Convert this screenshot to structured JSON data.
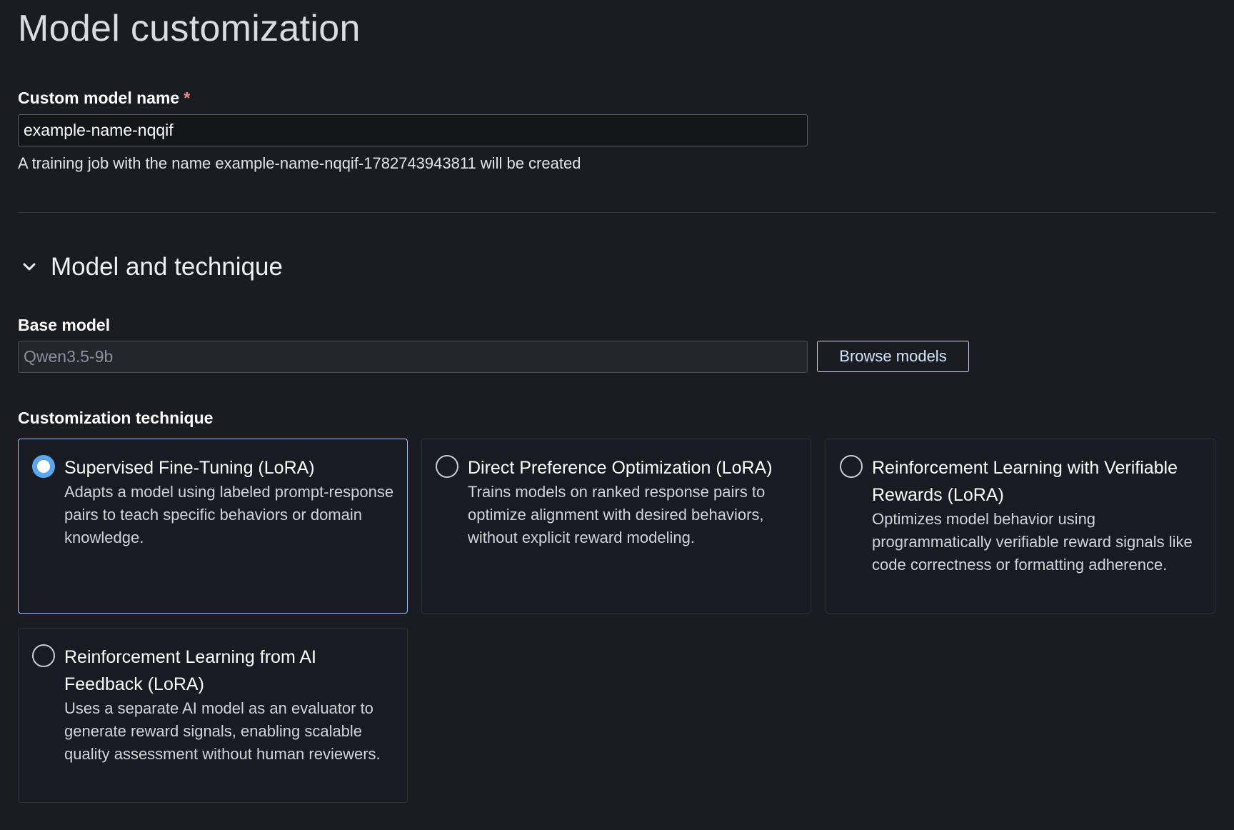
{
  "page": {
    "title": "Model customization"
  },
  "custom_model_name": {
    "label": "Custom model name",
    "required_marker": "*",
    "value": "example-name-nqqif",
    "hint": "A training job with the name example-name-nqqif-1782743943811 will be created"
  },
  "model_section": {
    "title": "Model and technique",
    "expanded": true,
    "base_model": {
      "label": "Base model",
      "value": "Qwen3.5-9b",
      "browse_label": "Browse models"
    },
    "technique": {
      "label": "Customization technique",
      "selected": "sft",
      "options": [
        {
          "id": "sft",
          "title": "Supervised Fine-Tuning (LoRA)",
          "description": "Adapts a model using labeled prompt-response pairs to teach specific behaviors or domain knowledge.",
          "selected": true
        },
        {
          "id": "dpo",
          "title": "Direct Preference Optimization (LoRA)",
          "description": "Trains models on ranked response pairs to optimize alignment with desired behaviors, without explicit reward modeling.",
          "selected": false
        },
        {
          "id": "rlvr",
          "title": "Reinforcement Learning with Verifiable Rewards (LoRA)",
          "description": "Optimizes model behavior using programmatically verifiable reward signals like code correctness or formatting adherence.",
          "selected": false
        },
        {
          "id": "rlaif",
          "title": "Reinforcement Learning from AI Feedback (LoRA)",
          "description": "Uses a separate AI model as an evaluator to generate reward signals, enabling scalable quality assessment without human reviewers.",
          "selected": false
        }
      ]
    }
  },
  "colors": {
    "background": "#1b1c21",
    "accent": "#5aa6ef",
    "selected_border": "#9ec3ee",
    "required": "#f48b82"
  }
}
